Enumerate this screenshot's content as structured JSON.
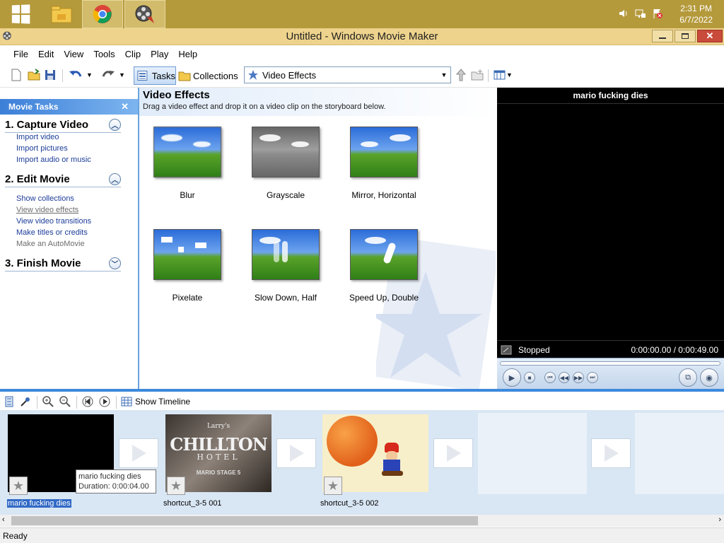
{
  "taskbar": {
    "time": "2:31 PM",
    "date": "6/7/2022",
    "apps": [
      "start-button",
      "file-explorer",
      "chrome",
      "movie-maker"
    ]
  },
  "window": {
    "title": "Untitled - Windows Movie Maker"
  },
  "menu": [
    "File",
    "Edit",
    "View",
    "Tools",
    "Clip",
    "Play",
    "Help"
  ],
  "toolbar": {
    "tasks_label": "Tasks",
    "collections_label": "Collections",
    "collection_selected": "Video Effects"
  },
  "tasks_pane": {
    "header": "Movie Tasks",
    "sections": [
      {
        "title": "1. Capture Video",
        "links": [
          "Import video",
          "Import pictures",
          "Import audio or music"
        ]
      },
      {
        "title": "2. Edit Movie",
        "links": [
          "Show collections",
          "View video effects",
          "View video transitions",
          "Make titles or credits",
          "Make an AutoMovie"
        ]
      },
      {
        "title": "3. Finish Movie",
        "links": []
      }
    ]
  },
  "effects": {
    "title": "Video Effects",
    "subtitle": "Drag a video effect and drop it on a video clip on the storyboard below.",
    "items": [
      "Blur",
      "Grayscale",
      "Mirror, Horizontal",
      "Pixelate",
      "Slow Down, Half",
      "Speed Up, Double"
    ]
  },
  "preview": {
    "title": "mario fucking dies",
    "status": "Stopped",
    "time": "0:00:00.00 / 0:00:49.00"
  },
  "storyboard_toolbar": {
    "show_timeline": "Show Timeline"
  },
  "storyboard": {
    "clips": [
      {
        "name": "mario fucking dies",
        "selected": true
      },
      {
        "name": "shortcut_3-5 001",
        "selected": false
      },
      {
        "name": "shortcut_3-5 002",
        "selected": false
      }
    ],
    "tooltip": {
      "line1": "mario fucking dies",
      "line2": "Duration:  0:00:04.00"
    },
    "chillton_text": [
      "Larry's",
      "CHILLTON",
      "HOTEL",
      "MARIO STAGE 5"
    ]
  },
  "statusbar": {
    "text": "Ready"
  },
  "colors": {
    "taskbar": "#b59a3c",
    "accent_blue": "#3d89dd",
    "link_blue": "#1c3c99"
  }
}
